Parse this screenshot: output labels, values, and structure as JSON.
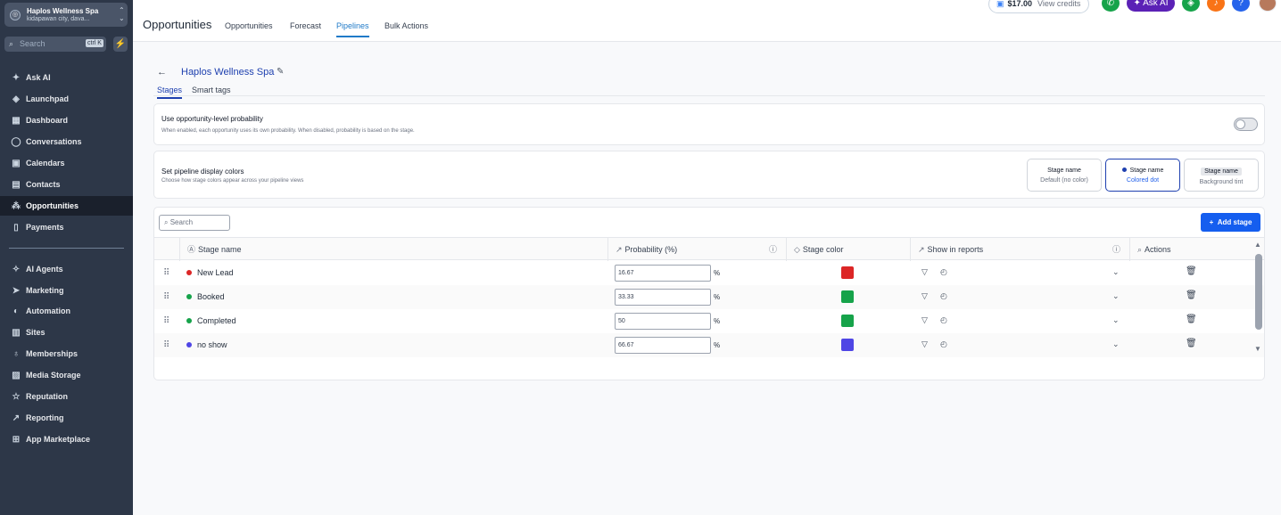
{
  "sidebar": {
    "account_name": "Haplos Wellness Spa",
    "account_location": "kidapawan city, dava...",
    "search_placeholder": "Search",
    "search_shortcut": "ctrl K",
    "items": [
      {
        "label": "Ask AI",
        "icon": "sparkle-icon"
      },
      {
        "label": "Launchpad",
        "icon": "rocket-icon"
      },
      {
        "label": "Dashboard",
        "icon": "grid-icon"
      },
      {
        "label": "Conversations",
        "icon": "chat-icon"
      },
      {
        "label": "Calendars",
        "icon": "calendar-icon"
      },
      {
        "label": "Contacts",
        "icon": "contacts-icon"
      },
      {
        "label": "Opportunities",
        "icon": "network-icon"
      },
      {
        "label": "Payments",
        "icon": "receipt-icon"
      },
      {
        "label": "AI Agents",
        "icon": "agents-icon"
      },
      {
        "label": "Marketing",
        "icon": "send-icon"
      },
      {
        "label": "Automation",
        "icon": "automation-icon"
      },
      {
        "label": "Sites",
        "icon": "sites-icon"
      },
      {
        "label": "Memberships",
        "icon": "badge-icon"
      },
      {
        "label": "Media Storage",
        "icon": "image-icon"
      },
      {
        "label": "Reputation",
        "icon": "star-icon"
      },
      {
        "label": "Reporting",
        "icon": "trend-icon"
      },
      {
        "label": "App Marketplace",
        "icon": "apps-icon"
      }
    ]
  },
  "header": {
    "title": "Opportunities",
    "tabs": [
      "Opportunities",
      "Forecast",
      "Pipelines",
      "Bulk Actions"
    ],
    "active_tab": "Pipelines",
    "credits_amount": "$17.00",
    "credits_label": "View credits",
    "ask_ai_label": "Ask AI"
  },
  "pipeline": {
    "name": "Haplos Wellness Spa",
    "subtabs": [
      "Stages",
      "Smart tags"
    ],
    "active_subtab": "Stages"
  },
  "probability_card": {
    "title": "Use opportunity-level probability",
    "description": "When enabled, each opportunity uses its own probability. When disabled, probability is based on the stage.",
    "enabled": false
  },
  "colors_card": {
    "title": "Set pipeline display colors",
    "description": "Choose how stage colors appear across your pipeline views",
    "options": [
      {
        "name": "Stage name",
        "sub": "Default (no color)"
      },
      {
        "name": "Stage name",
        "sub": "Colored dot"
      },
      {
        "name": "Stage name",
        "sub": "Background tint"
      }
    ],
    "selected": "Colored dot"
  },
  "stages_table": {
    "search_placeholder": "Search",
    "add_button": "Add stage",
    "columns": [
      "Stage name",
      "Probability (%)",
      "Stage color",
      "Show in reports",
      "Actions"
    ],
    "rows": [
      {
        "name": "New Lead",
        "probability": "16.67",
        "unit": "%",
        "color": "#dc2626"
      },
      {
        "name": "Booked",
        "probability": "33.33",
        "unit": "%",
        "color": "#16a34a"
      },
      {
        "name": "Completed",
        "probability": "50",
        "unit": "%",
        "color": "#16a34a"
      },
      {
        "name": "no show",
        "probability": "66.67",
        "unit": "%",
        "color": "#4f46e5"
      }
    ]
  },
  "colors": {
    "sidebar_bg": "#2d3748",
    "accent": "#155eef",
    "link": "#1e40af"
  }
}
